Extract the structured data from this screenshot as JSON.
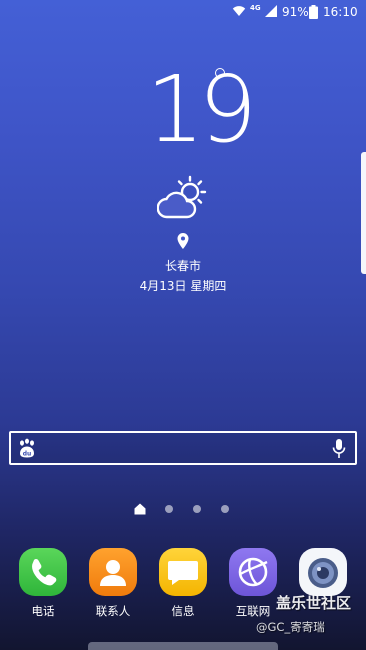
{
  "status_bar": {
    "network_type": "4G",
    "battery": "91%",
    "time": "16:10",
    "icons": [
      "wifi-icon",
      "signal-icon",
      "battery-icon"
    ]
  },
  "weather": {
    "temperature": "19",
    "city": "长春市",
    "date": "4月13日 星期四",
    "icon": "partly-sunny-icon"
  },
  "search_bar": {
    "left_icon": "baidu-icon",
    "right_icon": "mic-icon"
  },
  "pages": {
    "count": 4,
    "current": 0
  },
  "dock": [
    {
      "label": "电话",
      "icon": "phone-icon",
      "color": "#3cc24a"
    },
    {
      "label": "联系人",
      "icon": "contacts-icon",
      "color": "#f5891a"
    },
    {
      "label": "信息",
      "icon": "messages-icon",
      "color": "#f9c20a"
    },
    {
      "label": "互联网",
      "icon": "internet-icon",
      "color": "#7c64e6"
    },
    {
      "label": "",
      "icon": "camera-icon",
      "color": "#f4f6fa"
    }
  ],
  "watermark": {
    "title": "盖乐世社区",
    "subtitle": "@GC_寄寄瑞"
  }
}
